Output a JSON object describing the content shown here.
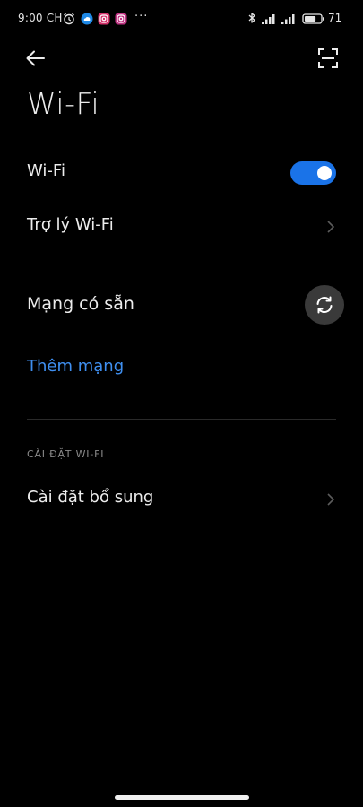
{
  "status_bar": {
    "time": "9:00 CH",
    "overflow": "···",
    "battery_percent": "71",
    "battery_level": 0.71,
    "icons": [
      "alarm-icon",
      "cloud-app-icon",
      "instagram-icon",
      "instagram-icon",
      "bluetooth-icon",
      "signal-icon",
      "signal-icon",
      "battery-icon"
    ]
  },
  "header": {
    "title": "Wi-Fi",
    "back_icon": "back-arrow-icon",
    "scan_icon": "scan-qr-icon"
  },
  "wifi_toggle": {
    "label": "Wi-Fi",
    "enabled": true
  },
  "assistant": {
    "label": "Trợ lý Wi-Fi"
  },
  "available_networks": {
    "label": "Mạng có sẵn",
    "refresh_icon": "refresh-icon"
  },
  "add_network": {
    "label": "Thêm mạng"
  },
  "settings_section": {
    "header": "CÀI ĐẶT WI-FI",
    "additional_settings_label": "Cài đặt bổ sung"
  },
  "colors": {
    "background": "#000000",
    "accent": "#1a73e8",
    "link": "#3f8ff0",
    "text": "#ececec",
    "secondary": "#8a8a8a"
  }
}
